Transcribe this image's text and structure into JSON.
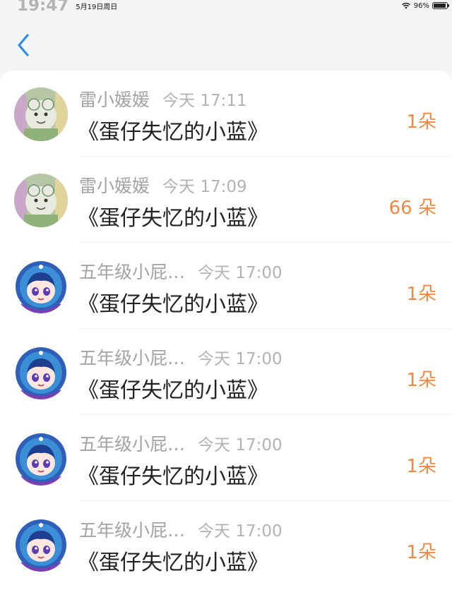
{
  "status_bar": {
    "time": "19:47",
    "date": "5月19日周日",
    "battery": "96%",
    "battery_level": 0.96
  },
  "colors": {
    "accent_blue": "#2e8de6",
    "count_orange": "#ee8a45"
  },
  "nav": {
    "back_icon": "chevron-left-icon"
  },
  "items": [
    {
      "avatar": "avatar-green-figure",
      "name": "雷小媛媛",
      "time": "今天 17:11",
      "title": "《蛋仔失忆的小蓝》",
      "count": "1朵"
    },
    {
      "avatar": "avatar-green-figure",
      "name": "雷小媛媛",
      "time": "今天 17:09",
      "title": "《蛋仔失忆的小蓝》",
      "count": "66 朵"
    },
    {
      "avatar": "avatar-blue-hood-character",
      "name": "五年级小屁…",
      "time": "今天 17:00",
      "title": "《蛋仔失忆的小蓝》",
      "count": "1朵"
    },
    {
      "avatar": "avatar-blue-hood-character",
      "name": "五年级小屁…",
      "time": "今天 17:00",
      "title": "《蛋仔失忆的小蓝》",
      "count": "1朵"
    },
    {
      "avatar": "avatar-blue-hood-character",
      "name": "五年级小屁…",
      "time": "今天 17:00",
      "title": "《蛋仔失忆的小蓝》",
      "count": "1朵"
    },
    {
      "avatar": "avatar-blue-hood-character",
      "name": "五年级小屁…",
      "time": "今天 17:00",
      "title": "《蛋仔失忆的小蓝》",
      "count": "1朵"
    }
  ]
}
